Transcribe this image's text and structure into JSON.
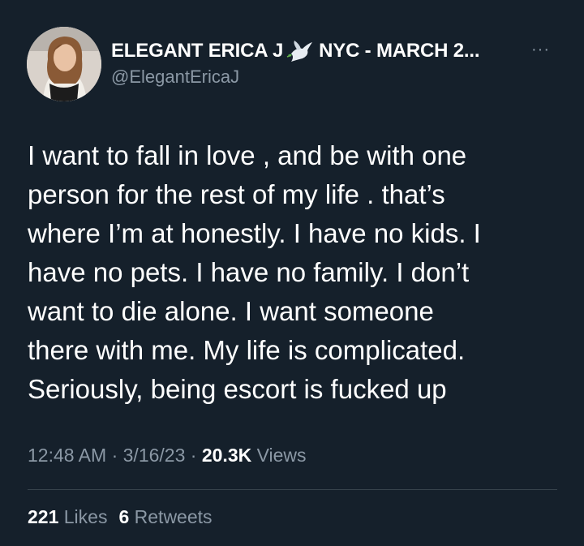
{
  "author": {
    "display_name": "ELEGANT ERICA J",
    "display_name_suffix": "NYC - MARCH 2...",
    "handle": "@ElegantEricaJ",
    "emoji_icon": "dove-icon"
  },
  "tweet": {
    "lines": [
      "I want to fall in love , and be with one",
      "person for the rest of my life . that’s",
      "where I’m at honestly. I have no kids. I",
      "have no pets. I have no family. I don’t",
      "want to die alone. I want someone",
      "there with me. My life is complicated.",
      "Seriously, being escort is fucked up"
    ]
  },
  "meta": {
    "time": "12:48 AM",
    "sep1": " · ",
    "date": "3/16/23",
    "sep2": " · ",
    "views_count": "20.3K",
    "views_label": "Views"
  },
  "stats": {
    "likes_count": "221",
    "likes_label": "Likes",
    "retweets_count": "6",
    "retweets_label": "Retweets"
  },
  "more_label": "···",
  "colors": {
    "background": "#15202b",
    "primary_text": "#ffffff",
    "secondary_text": "#8b98a5",
    "divider": "#38444d"
  }
}
